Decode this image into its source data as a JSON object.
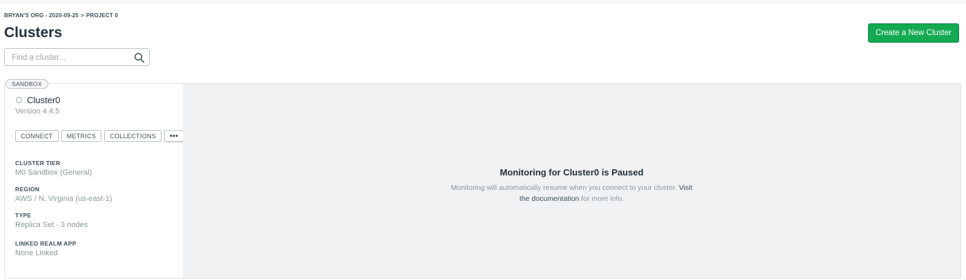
{
  "breadcrumb": {
    "org": "BRYAN'S ORG - 2020-09-25",
    "separator": ">",
    "project": "PROJECT 0"
  },
  "page": {
    "title": "Clusters"
  },
  "search": {
    "placeholder": "Find a cluster...",
    "value": "",
    "icon": "search-icon"
  },
  "create_button": {
    "label": "Create a New Cluster",
    "color": "#13aa52"
  },
  "cluster": {
    "badge": "SANDBOX",
    "name": "Cluster0",
    "version": "Version 4.4.5",
    "actions": [
      "CONNECT",
      "METRICS",
      "COLLECTIONS",
      "•••"
    ],
    "tier_label": "CLUSTER TIER",
    "tier_value": "M0 Sandbox (General)",
    "region_label": "REGION",
    "region_value": "AWS / N. Virginia (us-east-1)",
    "type_label": "TYPE",
    "type_value": "Replica Set - 3 nodes",
    "realm_label": "LINKED REALM APP",
    "realm_value": "None Linked"
  },
  "monitoring": {
    "title": "Monitoring for Cluster0 is Paused",
    "line1": "Monitoring will automatically resume when you connect to your cluster.",
    "visit": "Visit",
    "doc_link": "the documentation",
    "line2_suffix": "for more info."
  }
}
